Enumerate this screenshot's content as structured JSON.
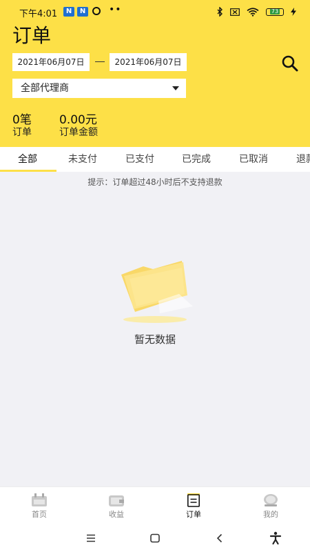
{
  "status_bar": {
    "time": "下午4:01",
    "badge1": "N",
    "badge2": "N",
    "dots": "••",
    "battery": "73"
  },
  "header": {
    "title": "订单",
    "date_start": "2021年06月07日",
    "date_end": "2021年06月07日",
    "agent_select": "全部代理商",
    "stats": {
      "count_value": "0笔",
      "count_label": "订单",
      "amount_value": "0.00元",
      "amount_label": "订单金额"
    },
    "accent_color": "#fde047"
  },
  "tabs": [
    {
      "label": "全部",
      "active": true
    },
    {
      "label": "未支付",
      "active": false
    },
    {
      "label": "已支付",
      "active": false
    },
    {
      "label": "已完成",
      "active": false
    },
    {
      "label": "已取消",
      "active": false
    },
    {
      "label": "退款",
      "active": false
    }
  ],
  "hint": "提示：订单超过48小时后不支持退款",
  "empty_state": {
    "text": "暂无数据",
    "icon": "empty-folder-icon"
  },
  "bottom_nav": [
    {
      "label": "首页",
      "icon": "home-calendar-icon",
      "active": false
    },
    {
      "label": "收益",
      "icon": "wallet-icon",
      "active": false
    },
    {
      "label": "订单",
      "icon": "order-list-icon",
      "active": true
    },
    {
      "label": "我的",
      "icon": "profile-icon",
      "active": false
    }
  ],
  "system_nav": {
    "menu_icon": "menu-icon",
    "home_icon": "home-square-icon",
    "back_icon": "back-icon",
    "accessibility_icon": "accessibility-icon"
  }
}
